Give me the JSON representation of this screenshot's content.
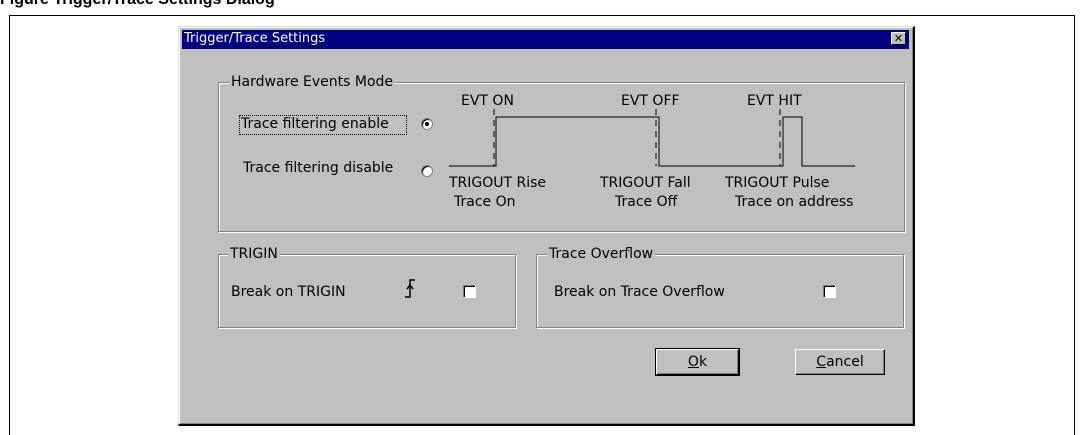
{
  "figure": {
    "caption": "Figure    Trigger/Trace Settings Dialog"
  },
  "dialog": {
    "title": "Trigger/Trace Settings",
    "close_glyph": "✕"
  },
  "hardware_events": {
    "legend": "Hardware Events Mode",
    "radio_enable": {
      "label": "Trace filtering enable",
      "selected": true
    },
    "radio_disable": {
      "label": "Trace filtering disable",
      "selected": false
    },
    "events": [
      "EVT ON",
      "EVT OFF",
      "EVT HIT"
    ],
    "trigout_labels": [
      "TRIGOUT  Rise",
      "TRIGOUT Fall",
      "TRIGOUT  Pulse"
    ],
    "trace_labels": [
      "Trace On",
      "Trace Off",
      "Trace on address"
    ]
  },
  "trigin": {
    "legend": "TRIGIN",
    "label": "Break on TRIGIN",
    "checked": false
  },
  "trace_overflow": {
    "legend": "Trace Overflow",
    "label": "Break on Trace Overflow",
    "checked": false
  },
  "buttons": {
    "ok_mnemonic": "O",
    "ok_rest": "k",
    "cancel_mnemonic": "C",
    "cancel_rest": "ancel"
  }
}
